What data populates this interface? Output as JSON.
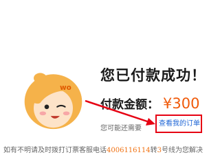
{
  "result": {
    "title": "您已付款成功！",
    "amount_label": "付款金额：",
    "amount_value": "¥300",
    "note": "您可能还需要",
    "order_link": "查看我的订单"
  },
  "hotline": {
    "prefix": "如有不明请及时拨打订票客服电话",
    "phone": "4006116114",
    "middle": "转",
    "ext": "3",
    "suffix": "号线为您解决"
  },
  "mascot": {
    "icon": "cartoon-girl-mascot",
    "hair_color": "#f5b24a",
    "skin_color": "#fde3c8"
  },
  "colors": {
    "accent": "#f05a0a",
    "link": "#1f66d6",
    "highlight_box": "#e60012",
    "arrow": "#e60012"
  }
}
